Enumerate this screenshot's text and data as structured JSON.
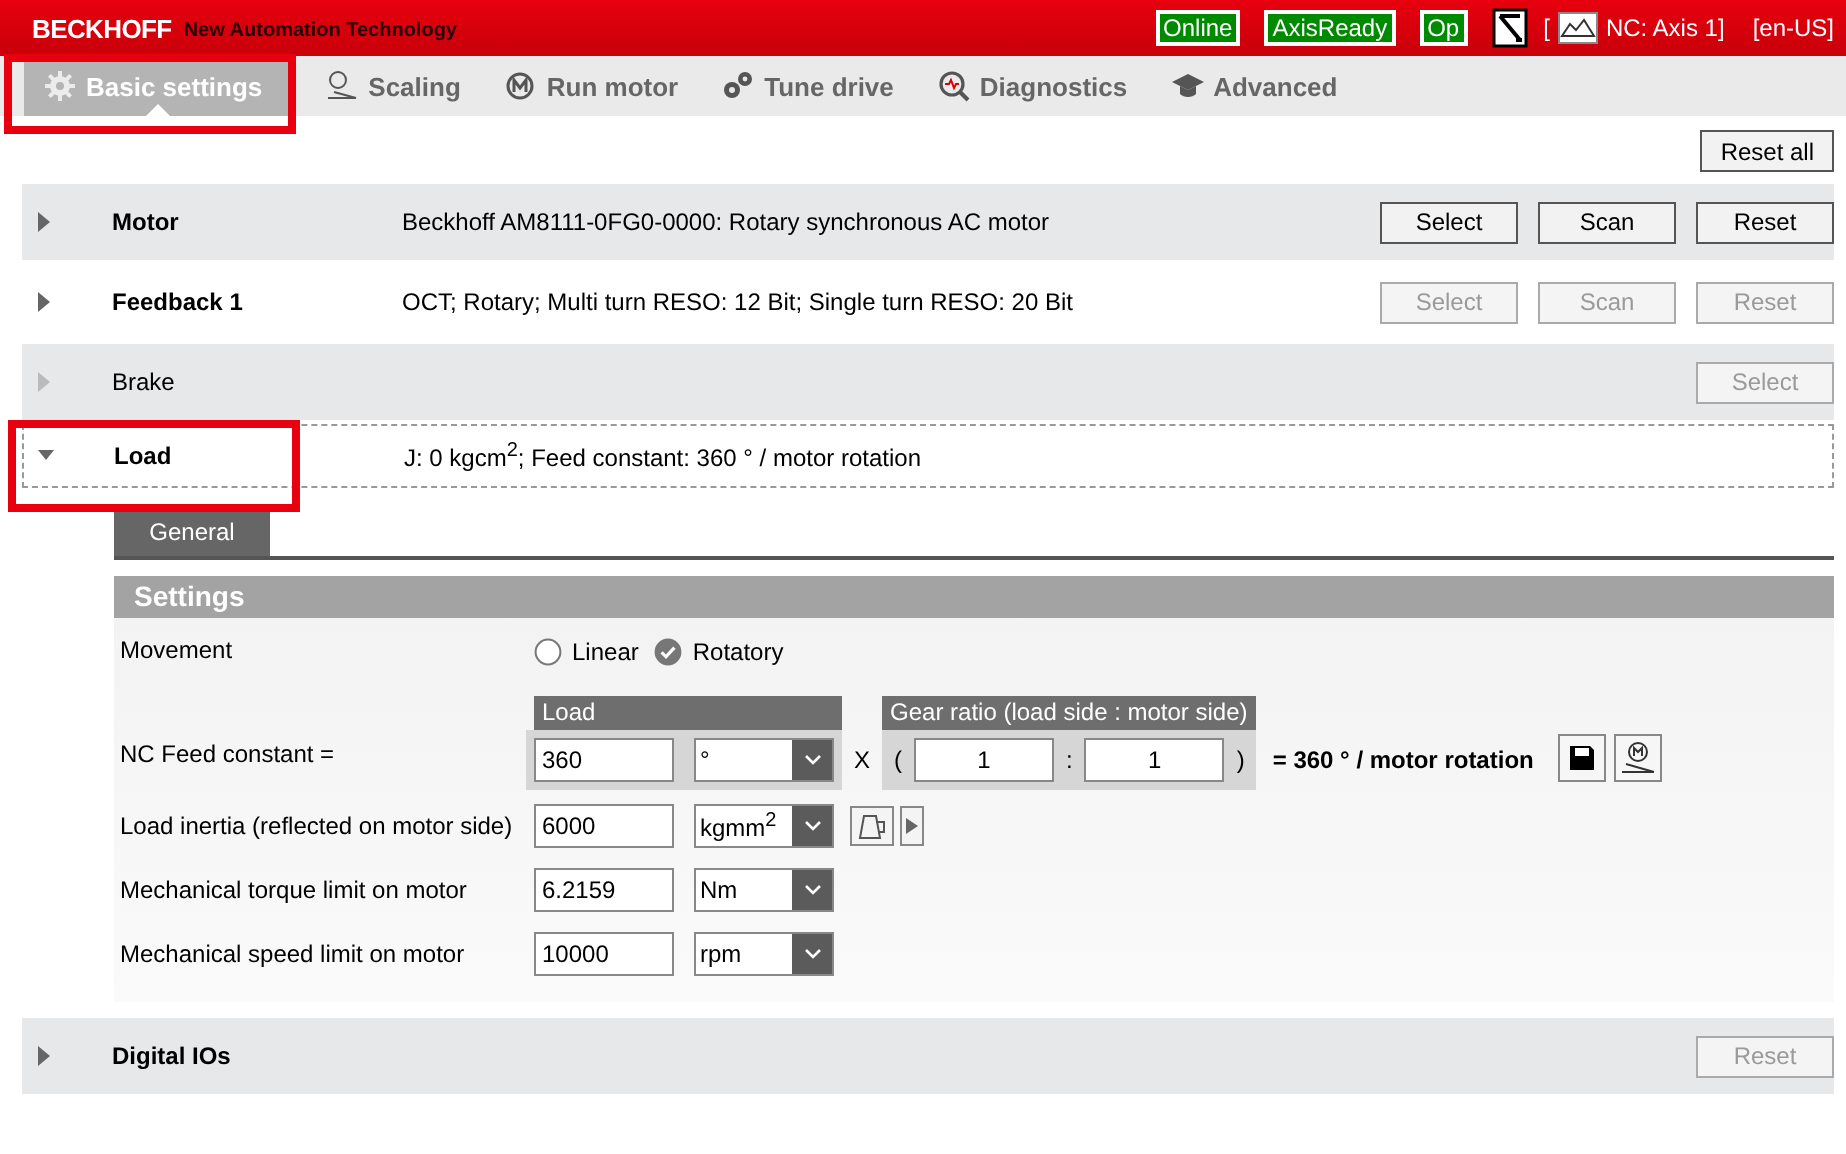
{
  "header": {
    "brand": "BECKHOFF",
    "tagline": "New Automation Technology",
    "statuses": [
      {
        "label": "Online",
        "ok": true
      },
      {
        "label": "AxisReady",
        "ok": true
      },
      {
        "label": "Op",
        "ok": true
      }
    ],
    "bracket": "[",
    "axis": "NC: Axis 1]",
    "locale": "[en-US]"
  },
  "tabs": [
    {
      "label": "Basic settings",
      "selected": true,
      "highlighted": true
    },
    {
      "label": "Scaling",
      "selected": false,
      "highlighted": false
    },
    {
      "label": "Run motor",
      "selected": false,
      "highlighted": false
    },
    {
      "label": "Tune drive",
      "selected": false,
      "highlighted": false
    },
    {
      "label": "Diagnostics",
      "selected": false,
      "highlighted": false
    },
    {
      "label": "Advanced",
      "selected": false,
      "highlighted": false
    }
  ],
  "reset_all": "Reset all",
  "sections": [
    {
      "title": "Motor",
      "summary": "Beckhoff AM8111-0FG0-0000: Rotary synchronous AC motor",
      "expanded": false,
      "disabled": false,
      "highlighted": false,
      "buttons": [
        {
          "label": "Select",
          "disabled": false
        },
        {
          "label": "Scan",
          "disabled": false
        },
        {
          "label": "Reset",
          "disabled": false
        }
      ]
    },
    {
      "title": "Feedback 1",
      "summary": "OCT; Rotary; Multi turn RESO: 12 Bit; Single turn RESO: 20 Bit",
      "expanded": false,
      "disabled": false,
      "highlighted": false,
      "buttons": [
        {
          "label": "Select",
          "disabled": true
        },
        {
          "label": "Scan",
          "disabled": true
        },
        {
          "label": "Reset",
          "disabled": true
        }
      ]
    },
    {
      "title": "Brake",
      "expanded": false,
      "disabled": true,
      "highlighted": false,
      "buttons": [
        {
          "label": "Select",
          "disabled": true
        }
      ]
    },
    {
      "title": "Load",
      "summary": "J: 0 kgcm$^{2}$; Feed constant: 360 ° / motor rotation",
      "expanded": true,
      "disabled": false,
      "highlighted": true,
      "panel": {
        "subtabs": [
          {
            "label": "General",
            "selected": true
          }
        ],
        "settings_title": "Settings",
        "rows": [
          {
            "kind": "radio",
            "label": "Movement",
            "options": [
              {
                "label": "Linear",
                "selected": false
              },
              {
                "label": "Rotatory",
                "selected": true
              }
            ]
          },
          {
            "kind": "feed",
            "label": "NC Feed constant =",
            "group_title": "Load",
            "value": "360",
            "unit": "°",
            "times": "X",
            "gear_title": "Gear ratio (load side : motor side)",
            "open": "(",
            "ratio_load": "1",
            "separator": ":",
            "ratio_motor": "1",
            "close": ")",
            "result": "= 360 ° / motor rotation"
          },
          {
            "kind": "unit",
            "label": "Load inertia (reflected on motor side)",
            "value": "6000",
            "unit": "kgmm$^{2}$",
            "tools": true
          },
          {
            "kind": "unit",
            "label": "Mechanical torque limit on motor",
            "value": "6.2159",
            "unit": "Nm",
            "tools": false
          },
          {
            "kind": "unit",
            "label": "Mechanical speed limit on motor",
            "value": "10000",
            "unit": "rpm",
            "tools": false
          }
        ]
      }
    },
    {
      "title": "Digital IOs",
      "expanded": false,
      "disabled": false,
      "highlighted": false,
      "buttons": [
        {
          "label": "Reset",
          "disabled": true
        }
      ]
    }
  ]
}
